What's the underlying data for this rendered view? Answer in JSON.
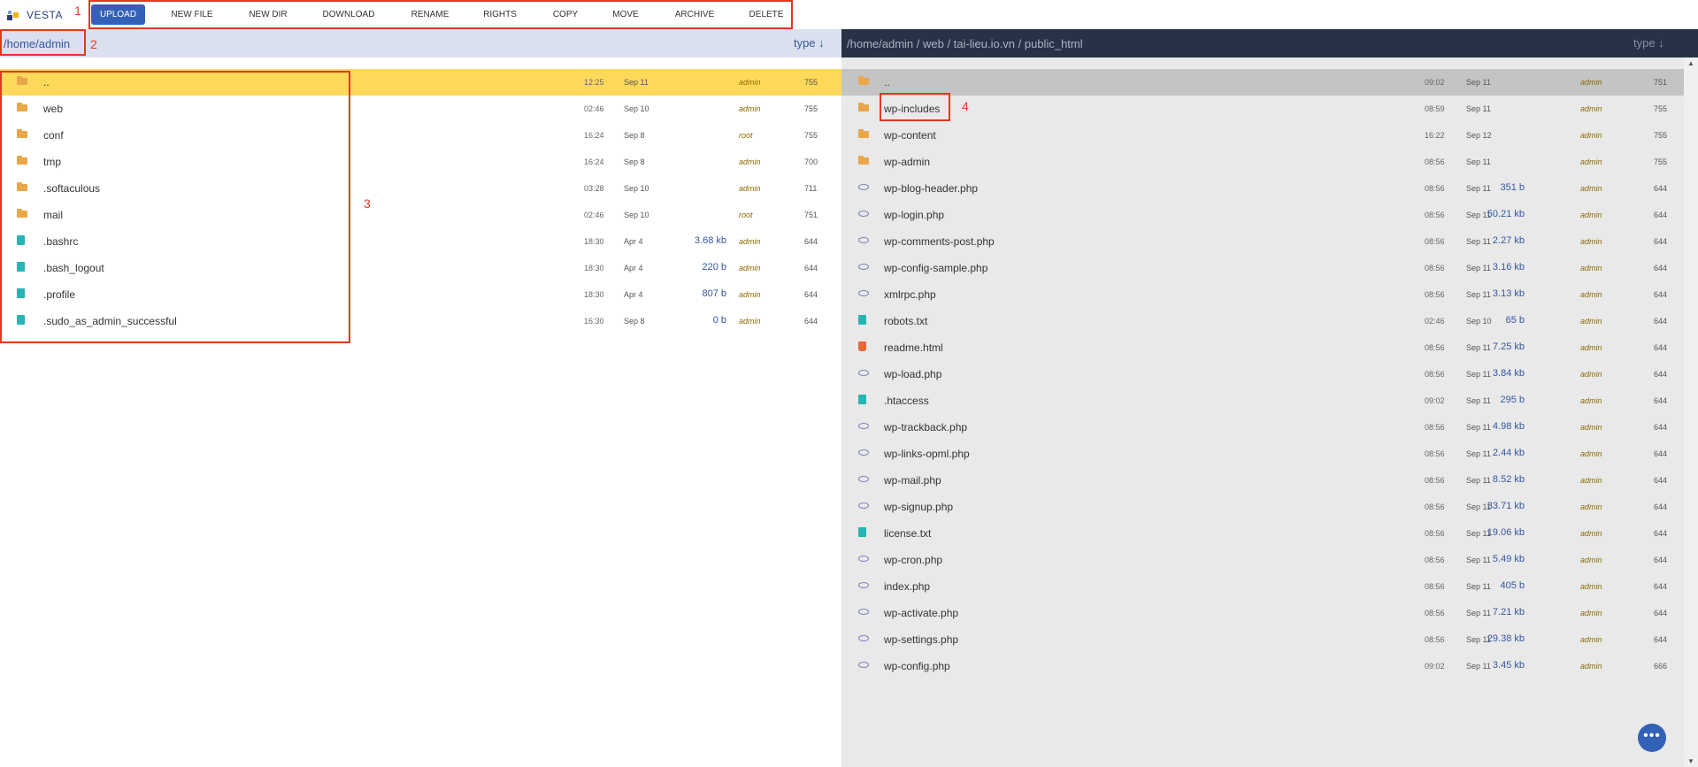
{
  "app": {
    "logo_text": "VESTA"
  },
  "toolbar": {
    "buttons": [
      "UPLOAD",
      "NEW FILE",
      "NEW DIR",
      "DOWNLOAD",
      "RENAME",
      "RIGHTS",
      "COPY",
      "MOVE",
      "ARCHIVE",
      "DELETE"
    ]
  },
  "annotations": {
    "a1": "1",
    "a2": "2",
    "a3": "3",
    "a4": "4"
  },
  "left": {
    "path": "/home/admin",
    "sort": "type ↓",
    "rows": [
      {
        "name": "..",
        "time": "12:25",
        "date": "Sep 11",
        "size": "",
        "owner": "admin",
        "perm": "755",
        "type": "folder"
      },
      {
        "name": "web",
        "time": "02:46",
        "date": "Sep 10",
        "size": "",
        "owner": "admin",
        "perm": "755",
        "type": "folder"
      },
      {
        "name": "conf",
        "time": "16:24",
        "date": "Sep 8",
        "size": "",
        "owner": "root",
        "perm": "755",
        "type": "folder"
      },
      {
        "name": "tmp",
        "time": "16:24",
        "date": "Sep 8",
        "size": "",
        "owner": "admin",
        "perm": "700",
        "type": "folder"
      },
      {
        "name": ".softaculous",
        "time": "03:28",
        "date": "Sep 10",
        "size": "",
        "owner": "admin",
        "perm": "711",
        "type": "folder"
      },
      {
        "name": "mail",
        "time": "02:46",
        "date": "Sep 10",
        "size": "",
        "owner": "root",
        "perm": "751",
        "type": "folder"
      },
      {
        "name": ".bashrc",
        "time": "18:30",
        "date": "Apr 4",
        "size": "3.68 kb",
        "owner": "admin",
        "perm": "644",
        "type": "file"
      },
      {
        "name": ".bash_logout",
        "time": "18:30",
        "date": "Apr 4",
        "size": "220 b",
        "owner": "admin",
        "perm": "644",
        "type": "file"
      },
      {
        "name": ".profile",
        "time": "18:30",
        "date": "Apr 4",
        "size": "807 b",
        "owner": "admin",
        "perm": "644",
        "type": "file"
      },
      {
        "name": ".sudo_as_admin_successful",
        "time": "16:30",
        "date": "Sep 8",
        "size": "0 b",
        "owner": "admin",
        "perm": "644",
        "type": "file"
      }
    ]
  },
  "right": {
    "path": "/home/admin / web / tai-lieu.io.vn / public_html",
    "sort": "type ↓",
    "rows": [
      {
        "name": "..",
        "time": "09:02",
        "date": "Sep 11",
        "size": "",
        "owner": "admin",
        "perm": "751",
        "type": "folder"
      },
      {
        "name": "wp-includes",
        "time": "08:59",
        "date": "Sep 11",
        "size": "",
        "owner": "admin",
        "perm": "755",
        "type": "folder"
      },
      {
        "name": "wp-content",
        "time": "16:22",
        "date": "Sep 12",
        "size": "",
        "owner": "admin",
        "perm": "755",
        "type": "folder"
      },
      {
        "name": "wp-admin",
        "time": "08:56",
        "date": "Sep 11",
        "size": "",
        "owner": "admin",
        "perm": "755",
        "type": "folder"
      },
      {
        "name": "wp-blog-header.php",
        "time": "08:56",
        "date": "Sep 11",
        "size": "351 b",
        "owner": "admin",
        "perm": "644",
        "type": "php"
      },
      {
        "name": "wp-login.php",
        "time": "08:56",
        "date": "Sep 11",
        "size": "50.21 kb",
        "owner": "admin",
        "perm": "644",
        "type": "php"
      },
      {
        "name": "wp-comments-post.php",
        "time": "08:56",
        "date": "Sep 11",
        "size": "2.27 kb",
        "owner": "admin",
        "perm": "644",
        "type": "php"
      },
      {
        "name": "wp-config-sample.php",
        "time": "08:56",
        "date": "Sep 11",
        "size": "3.16 kb",
        "owner": "admin",
        "perm": "644",
        "type": "php"
      },
      {
        "name": "xmlrpc.php",
        "time": "08:56",
        "date": "Sep 11",
        "size": "3.13 kb",
        "owner": "admin",
        "perm": "644",
        "type": "php"
      },
      {
        "name": "robots.txt",
        "time": "02:46",
        "date": "Sep 10",
        "size": "65 b",
        "owner": "admin",
        "perm": "644",
        "type": "file"
      },
      {
        "name": "readme.html",
        "time": "08:56",
        "date": "Sep 11",
        "size": "7.25 kb",
        "owner": "admin",
        "perm": "644",
        "type": "html"
      },
      {
        "name": "wp-load.php",
        "time": "08:56",
        "date": "Sep 11",
        "size": "3.84 kb",
        "owner": "admin",
        "perm": "644",
        "type": "php"
      },
      {
        "name": ".htaccess",
        "time": "09:02",
        "date": "Sep 11",
        "size": "295 b",
        "owner": "admin",
        "perm": "644",
        "type": "file"
      },
      {
        "name": "wp-trackback.php",
        "time": "08:56",
        "date": "Sep 11",
        "size": "4.98 kb",
        "owner": "admin",
        "perm": "644",
        "type": "php"
      },
      {
        "name": "wp-links-opml.php",
        "time": "08:56",
        "date": "Sep 11",
        "size": "2.44 kb",
        "owner": "admin",
        "perm": "644",
        "type": "php"
      },
      {
        "name": "wp-mail.php",
        "time": "08:56",
        "date": "Sep 11",
        "size": "8.52 kb",
        "owner": "admin",
        "perm": "644",
        "type": "php"
      },
      {
        "name": "wp-signup.php",
        "time": "08:56",
        "date": "Sep 11",
        "size": "33.71 kb",
        "owner": "admin",
        "perm": "644",
        "type": "php"
      },
      {
        "name": "license.txt",
        "time": "08:56",
        "date": "Sep 11",
        "size": "19.06 kb",
        "owner": "admin",
        "perm": "644",
        "type": "file"
      },
      {
        "name": "wp-cron.php",
        "time": "08:56",
        "date": "Sep 11",
        "size": "5.49 kb",
        "owner": "admin",
        "perm": "644",
        "type": "php"
      },
      {
        "name": "index.php",
        "time": "08:56",
        "date": "Sep 11",
        "size": "405 b",
        "owner": "admin",
        "perm": "644",
        "type": "php"
      },
      {
        "name": "wp-activate.php",
        "time": "08:56",
        "date": "Sep 11",
        "size": "7.21 kb",
        "owner": "admin",
        "perm": "644",
        "type": "php"
      },
      {
        "name": "wp-settings.php",
        "time": "08:56",
        "date": "Sep 11",
        "size": "29.38 kb",
        "owner": "admin",
        "perm": "644",
        "type": "php"
      },
      {
        "name": "wp-config.php",
        "time": "09:02",
        "date": "Sep 11",
        "size": "3.45 kb",
        "owner": "admin",
        "perm": "666",
        "type": "php"
      }
    ]
  },
  "fab": {
    "label": "•••"
  },
  "colors": {
    "accent": "#3461b8",
    "selected_left": "#ffd95a",
    "selected_right": "#c4c4c4",
    "annotation": "#e0391f"
  }
}
